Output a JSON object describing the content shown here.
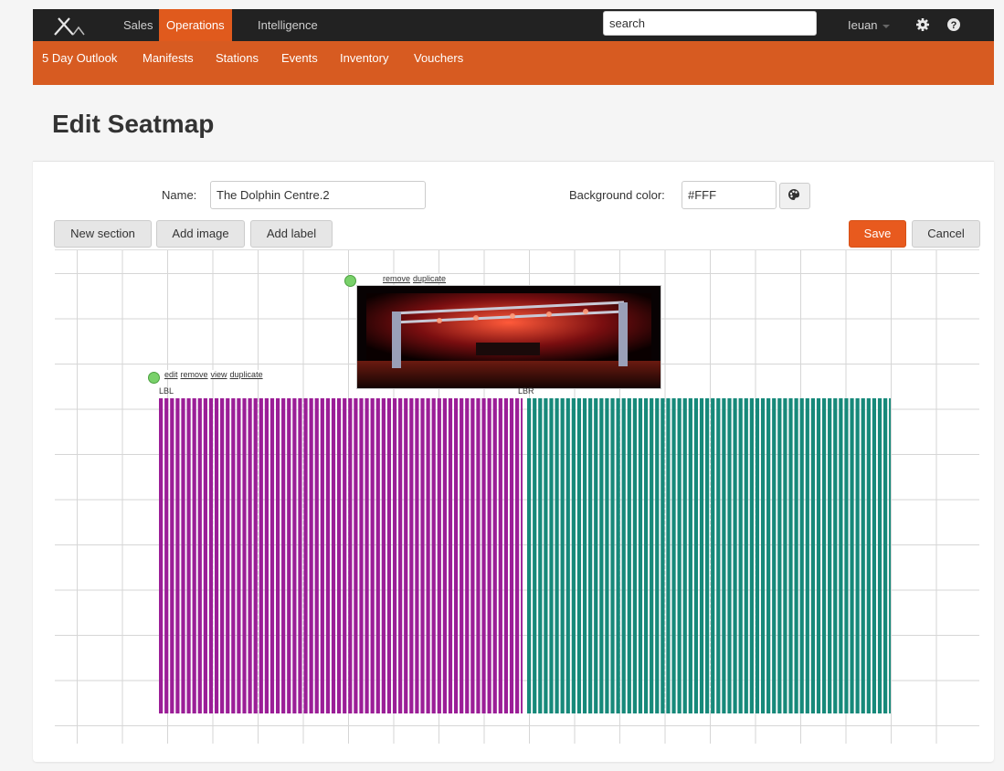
{
  "topnav": {
    "items": [
      "Sales",
      "Operations",
      "Intelligence"
    ],
    "active": "Operations",
    "search_value": "search",
    "user": "Ieuan"
  },
  "subnav": {
    "items": [
      "5 Day Outlook",
      "Manifests",
      "Stations",
      "Events",
      "Inventory",
      "Vouchers"
    ]
  },
  "page": {
    "title": "Edit Seatmap"
  },
  "form": {
    "name_label": "Name:",
    "name_value": "The Dolphin Centre.2",
    "bg_label": "Background color:",
    "bg_value": "#FFF"
  },
  "toolbar": {
    "new_section": "New section",
    "add_image": "Add image",
    "add_label": "Add label",
    "save": "Save",
    "cancel": "Cancel"
  },
  "canvas": {
    "image_links": [
      "remove",
      "duplicate"
    ],
    "section_links": [
      "edit",
      "remove",
      "view",
      "duplicate"
    ],
    "sections": [
      {
        "label": "LBL",
        "color": "#9b1e97"
      },
      {
        "label": "LBR",
        "color": "#17897a"
      }
    ]
  },
  "colors": {
    "accent": "#e05a1d",
    "topbar": "#222222",
    "subbar": "#d75b21",
    "handle": "#79d16a"
  }
}
